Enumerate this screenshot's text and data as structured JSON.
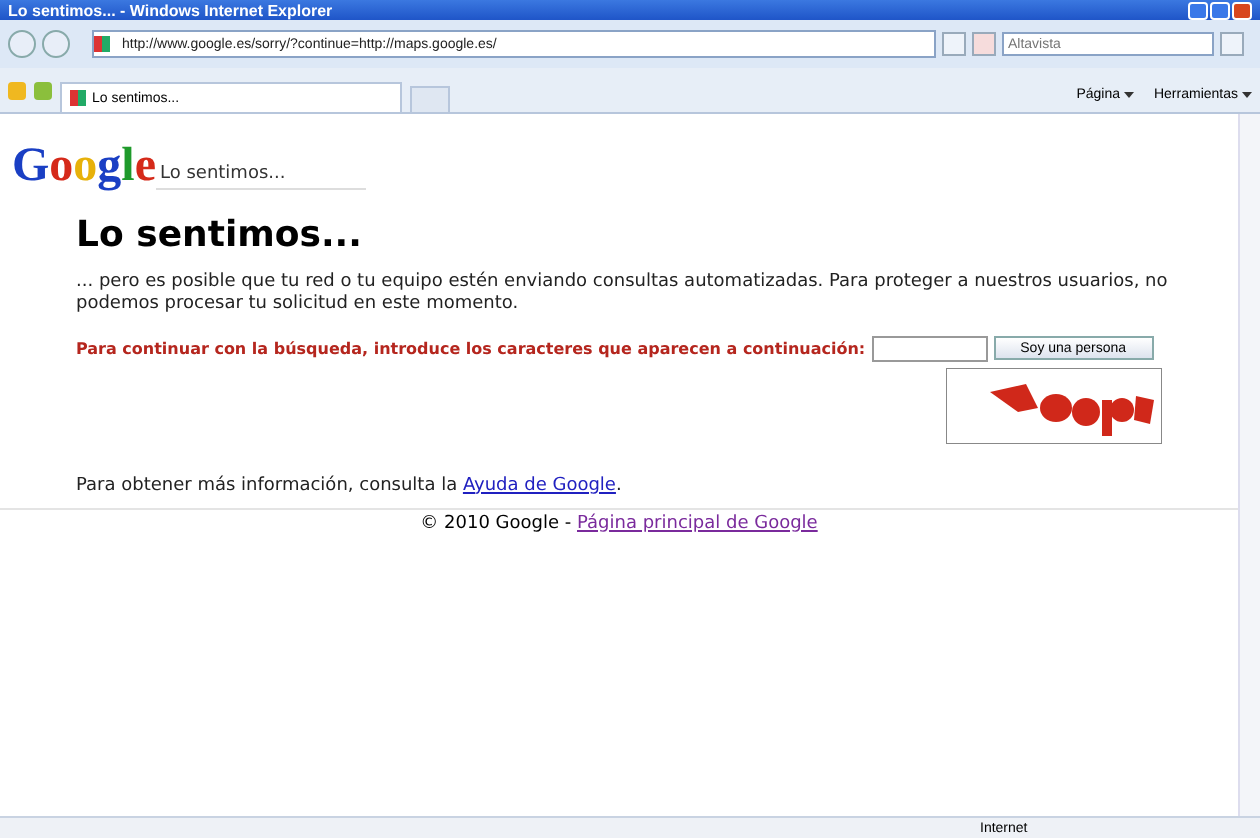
{
  "window": {
    "title": "Lo sentimos... - Windows Internet Explorer"
  },
  "address_bar": {
    "url": "http://www.google.es/sorry/?continue=http://maps.google.es/"
  },
  "search": {
    "placeholder": "Altavista"
  },
  "tabs": [
    {
      "label": "Lo sentimos...",
      "selected": true
    }
  ],
  "toolbar": {
    "items": [
      "Página",
      "Herramientas"
    ]
  },
  "page": {
    "logo": "Google",
    "header": "Lo sentimos...",
    "heading": "Lo sentimos...",
    "message": "... pero es posible que tu red o tu equipo estén enviando consultas automatizadas. Para proteger a nuestros usuarios, no podemos procesar tu solicitud en este momento.",
    "captcha_prompt": "Para continuar con la búsqueda, introduce los caracteres que aparecen a continuación:",
    "captcha_button": "Soy una persona",
    "info_text": "Para obtener más información, consulta la ",
    "info_link": "Ayuda de Google",
    "info_end": ".",
    "footer_text": "© 2010 Google - ",
    "footer_link": "Página principal de Google"
  },
  "status_bar": {
    "zone": "Internet"
  }
}
